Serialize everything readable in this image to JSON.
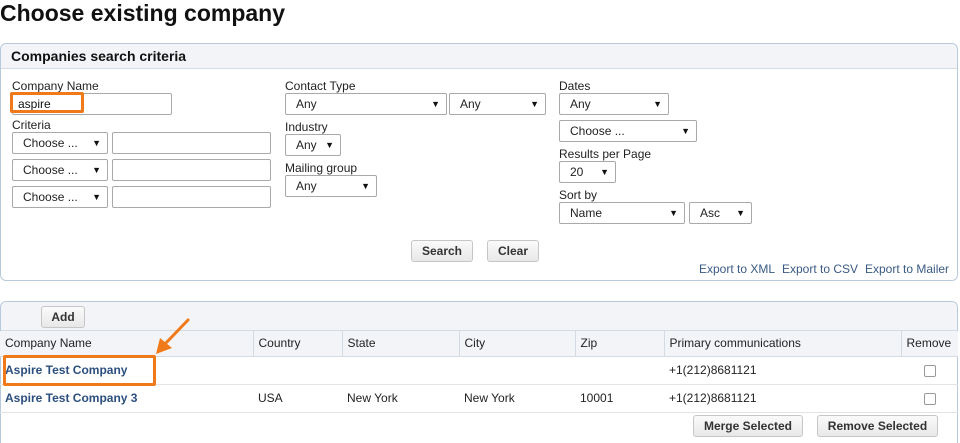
{
  "page": {
    "title": "Choose existing company"
  },
  "criteria": {
    "header": "Companies search criteria",
    "company_name_label": "Company Name",
    "company_name_value": "aspire",
    "criteria_label": "Criteria",
    "criteria_rows": [
      {
        "select": "Choose ...",
        "value": ""
      },
      {
        "select": "Choose ...",
        "value": ""
      },
      {
        "select": "Choose ...",
        "value": ""
      }
    ],
    "contact_type_label": "Contact Type",
    "contact_type_1": "Any",
    "contact_type_2": "Any",
    "industry_label": "Industry",
    "industry_value": "Any",
    "mailing_group_label": "Mailing group",
    "mailing_group_value": "Any",
    "dates_label": "Dates",
    "dates_value": "Any",
    "dates_choose": "Choose ...",
    "results_per_page_label": "Results per Page",
    "results_per_page_value": "20",
    "sort_by_label": "Sort by",
    "sort_by_value": "Name",
    "sort_order_value": "Asc",
    "search_button": "Search",
    "clear_button": "Clear",
    "export_xml": "Export to XML",
    "export_csv": "Export to CSV",
    "export_mailer": "Export to Mailer"
  },
  "results": {
    "add_button": "Add",
    "columns": [
      "Company Name",
      "Country",
      "State",
      "City",
      "Zip",
      "Primary communications",
      "Remove"
    ],
    "rows": [
      {
        "company": "Aspire Test Company",
        "country": "",
        "state": "",
        "city": "",
        "zip": "",
        "phone": "+1(212)8681121"
      },
      {
        "company": "Aspire Test Company 3",
        "country": "USA",
        "state": "New York",
        "city": "New York",
        "zip": "10001",
        "phone": "+1(212)8681121"
      }
    ],
    "merge_button": "Merge Selected",
    "remove_button": "Remove Selected"
  },
  "colors": {
    "highlight": "#f07a1a",
    "link": "#2b4f7e",
    "panel_border": "#b9c9dc"
  },
  "icons": {
    "dropdown": "chevron-down-icon",
    "annotation": "arrow-icon"
  }
}
